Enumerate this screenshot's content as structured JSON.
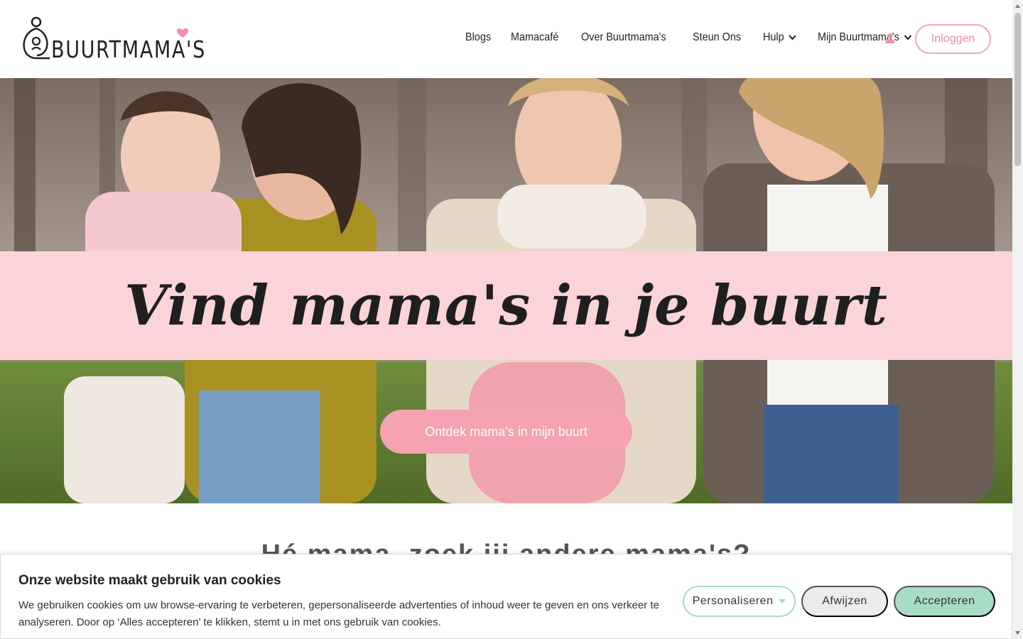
{
  "logo": {
    "text": "BUURTMAMA'S"
  },
  "nav": {
    "items": [
      {
        "label": "Blogs"
      },
      {
        "label": "Mamacafé"
      },
      {
        "label": "Over Buurtmama's"
      },
      {
        "label": "Steun Ons"
      },
      {
        "label": "Hulp",
        "dropdown": true
      },
      {
        "label": "Mijn Buurtmama's",
        "dropdown": true
      }
    ],
    "user_icon": "user-icon",
    "login_label": "Inloggen"
  },
  "hero": {
    "headline": "Vind mama's in je buurt",
    "cta_label": "Ontdek mama's in mijn buurt"
  },
  "section": {
    "heading": "Hé mama, zoek jij andere mama's?"
  },
  "cookie": {
    "title": "Onze website maakt gebruik van cookies",
    "text": "We gebruiken cookies om uw browse-ervaring te verbeteren, gepersonaliseerde advertenties of inhoud weer te geven en ons verkeer te analyseren. Door op ‘Alles accepteren’ te klikken, stemt u in met ons gebruik van cookies.",
    "personalize_label": "Personaliseren",
    "reject_label": "Afwijzen",
    "accept_label": "Accepteren"
  },
  "colors": {
    "brand_pink": "#f5a3b0",
    "banner_pink": "#fbd4d9",
    "mint": "#a8dcc4"
  }
}
